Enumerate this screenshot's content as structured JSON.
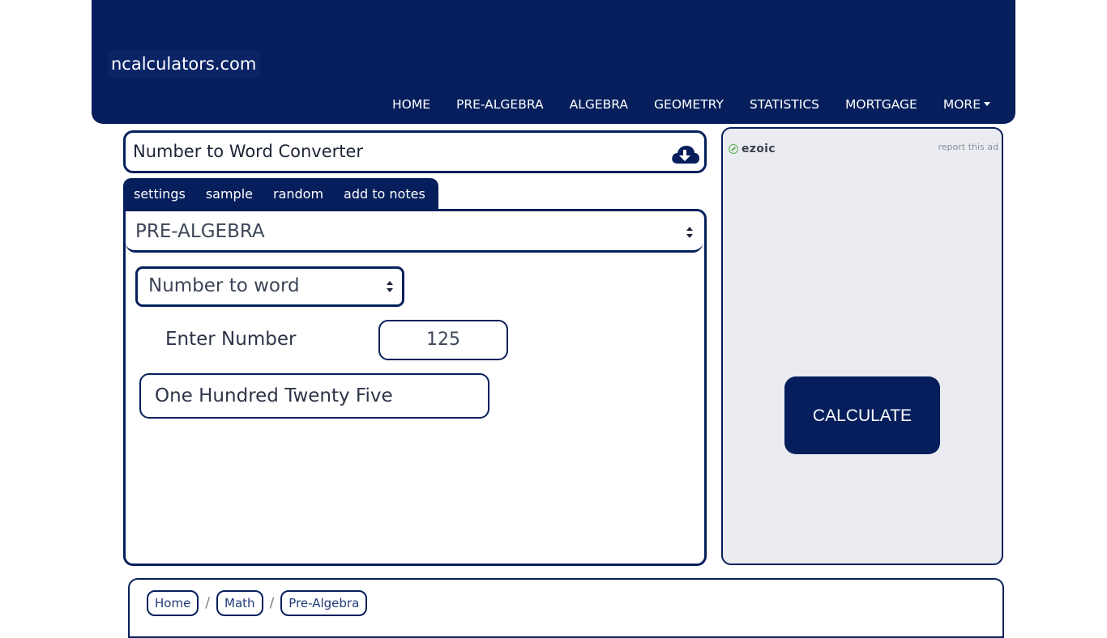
{
  "header": {
    "brand": "ncalculators.com",
    "nav": [
      {
        "label": "HOME"
      },
      {
        "label": "PRE-ALGEBRA"
      },
      {
        "label": "ALGEBRA"
      },
      {
        "label": "GEOMETRY"
      },
      {
        "label": "STATISTICS"
      },
      {
        "label": "MORTGAGE"
      },
      {
        "label": "MORE"
      }
    ]
  },
  "calculator": {
    "title": "Number to Word Converter",
    "download_icon": "cloud-download-icon",
    "tabs": [
      {
        "label": "settings"
      },
      {
        "label": "sample"
      },
      {
        "label": "random"
      },
      {
        "label": "add to notes"
      }
    ],
    "category_select": {
      "value": "PRE-ALGEBRA"
    },
    "mode_select": {
      "value": "Number to word"
    },
    "enter_label": "Enter Number",
    "number_value": "125",
    "result": "One Hundred Twenty Five"
  },
  "ad": {
    "brand": "ezoic",
    "report": "report this ad",
    "calculate_label": "CALCULATE"
  },
  "breadcrumb": {
    "items": [
      {
        "label": "Home"
      },
      {
        "label": "Math"
      },
      {
        "label": "Pre-Algebra"
      }
    ],
    "separator": "/"
  },
  "colors": {
    "primary": "#061f5c",
    "ad_bg": "#ebecf1",
    "ezoic_green": "#5bb04a"
  }
}
